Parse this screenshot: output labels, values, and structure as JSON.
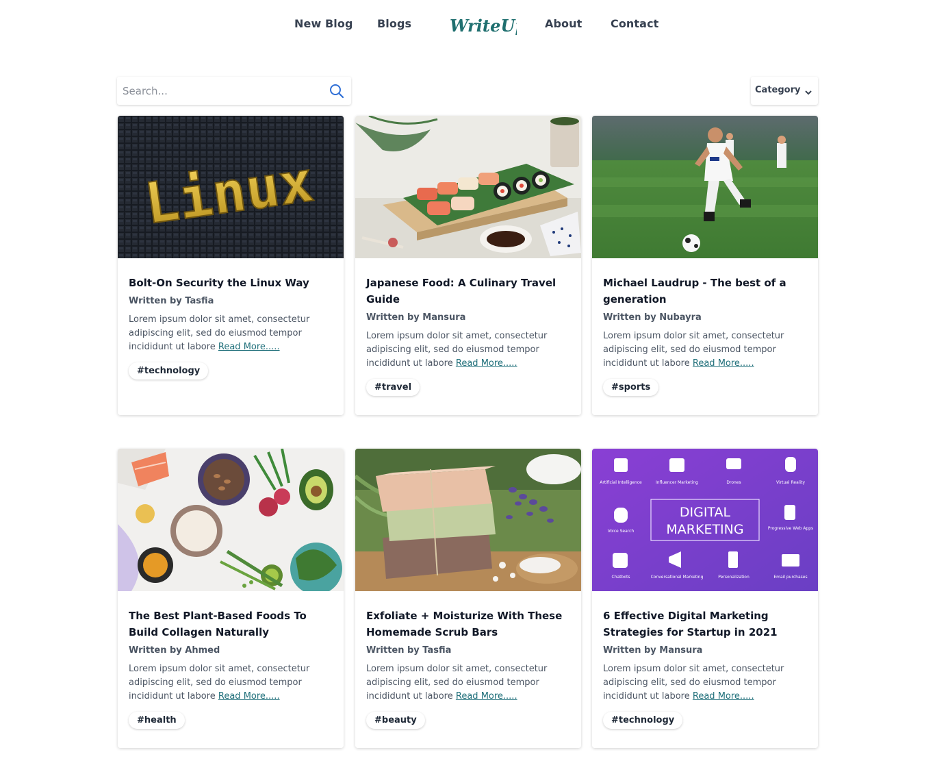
{
  "nav": {
    "new_blog": "New Blog",
    "blogs": "Blogs",
    "logo": "WriteUp",
    "about": "About",
    "contact": "Contact"
  },
  "search": {
    "placeholder": "Search...",
    "icon": "search-icon"
  },
  "category": {
    "label": "Category",
    "icon": "chevron-down-icon"
  },
  "posts": [
    {
      "title": "Bolt-On Security the Linux Way",
      "author": "Written by Tasfia",
      "excerpt": "Lorem ipsum dolor sit amet, consectetur adipiscing elit, sed do eiusmod tempor incididunt ut labore",
      "more": "Read More.....",
      "tag": "#technology",
      "image_text": "Linux"
    },
    {
      "title": "Japanese Food: A Culinary Travel Guide",
      "author": "Written by Mansura",
      "excerpt": "Lorem ipsum dolor sit amet, consectetur adipiscing elit, sed do eiusmod tempor incididunt ut labore",
      "more": "Read More.....",
      "tag": "#travel"
    },
    {
      "title": "Michael Laudrup - The best of a generation",
      "author": "Written by Nubayra",
      "excerpt": "Lorem ipsum dolor sit amet, consectetur adipiscing elit, sed do eiusmod tempor incididunt ut labore",
      "more": "Read More.....",
      "tag": "#sports"
    },
    {
      "title": "The Best Plant-Based Foods To Build Collagen Naturally",
      "author": "Written by Ahmed",
      "excerpt": "Lorem ipsum dolor sit amet, consectetur adipiscing elit, sed do eiusmod tempor incididunt ut labore",
      "more": "Read More.....",
      "tag": "#health"
    },
    {
      "title": "Exfoliate + Moisturize With These Homemade Scrub Bars",
      "author": "Written by Tasfia",
      "excerpt": "Lorem ipsum dolor sit amet, consectetur adipiscing elit, sed do eiusmod tempor incididunt ut labore",
      "more": "Read More.....",
      "tag": "#beauty"
    },
    {
      "title": "6 Effective Digital Marketing Strategies for Startup in 2021",
      "author": "Written by Mansura",
      "excerpt": "Lorem ipsum dolor sit amet, consectetur adipiscing elit, sed do eiusmod tempor incididunt ut labore",
      "more": "Read More.....",
      "tag": "#technology",
      "image_text": {
        "headline_1": "DIGITAL",
        "headline_2": "MARKETING",
        "items": [
          "Artificial Intelligence",
          "Influencer Marketing",
          "Drones",
          "Virtual Reality",
          "Voice Search",
          "Progressive Web Apps",
          "Chatbots",
          "Conversational Marketing",
          "Personalization",
          "Email purchases"
        ]
      }
    }
  ]
}
